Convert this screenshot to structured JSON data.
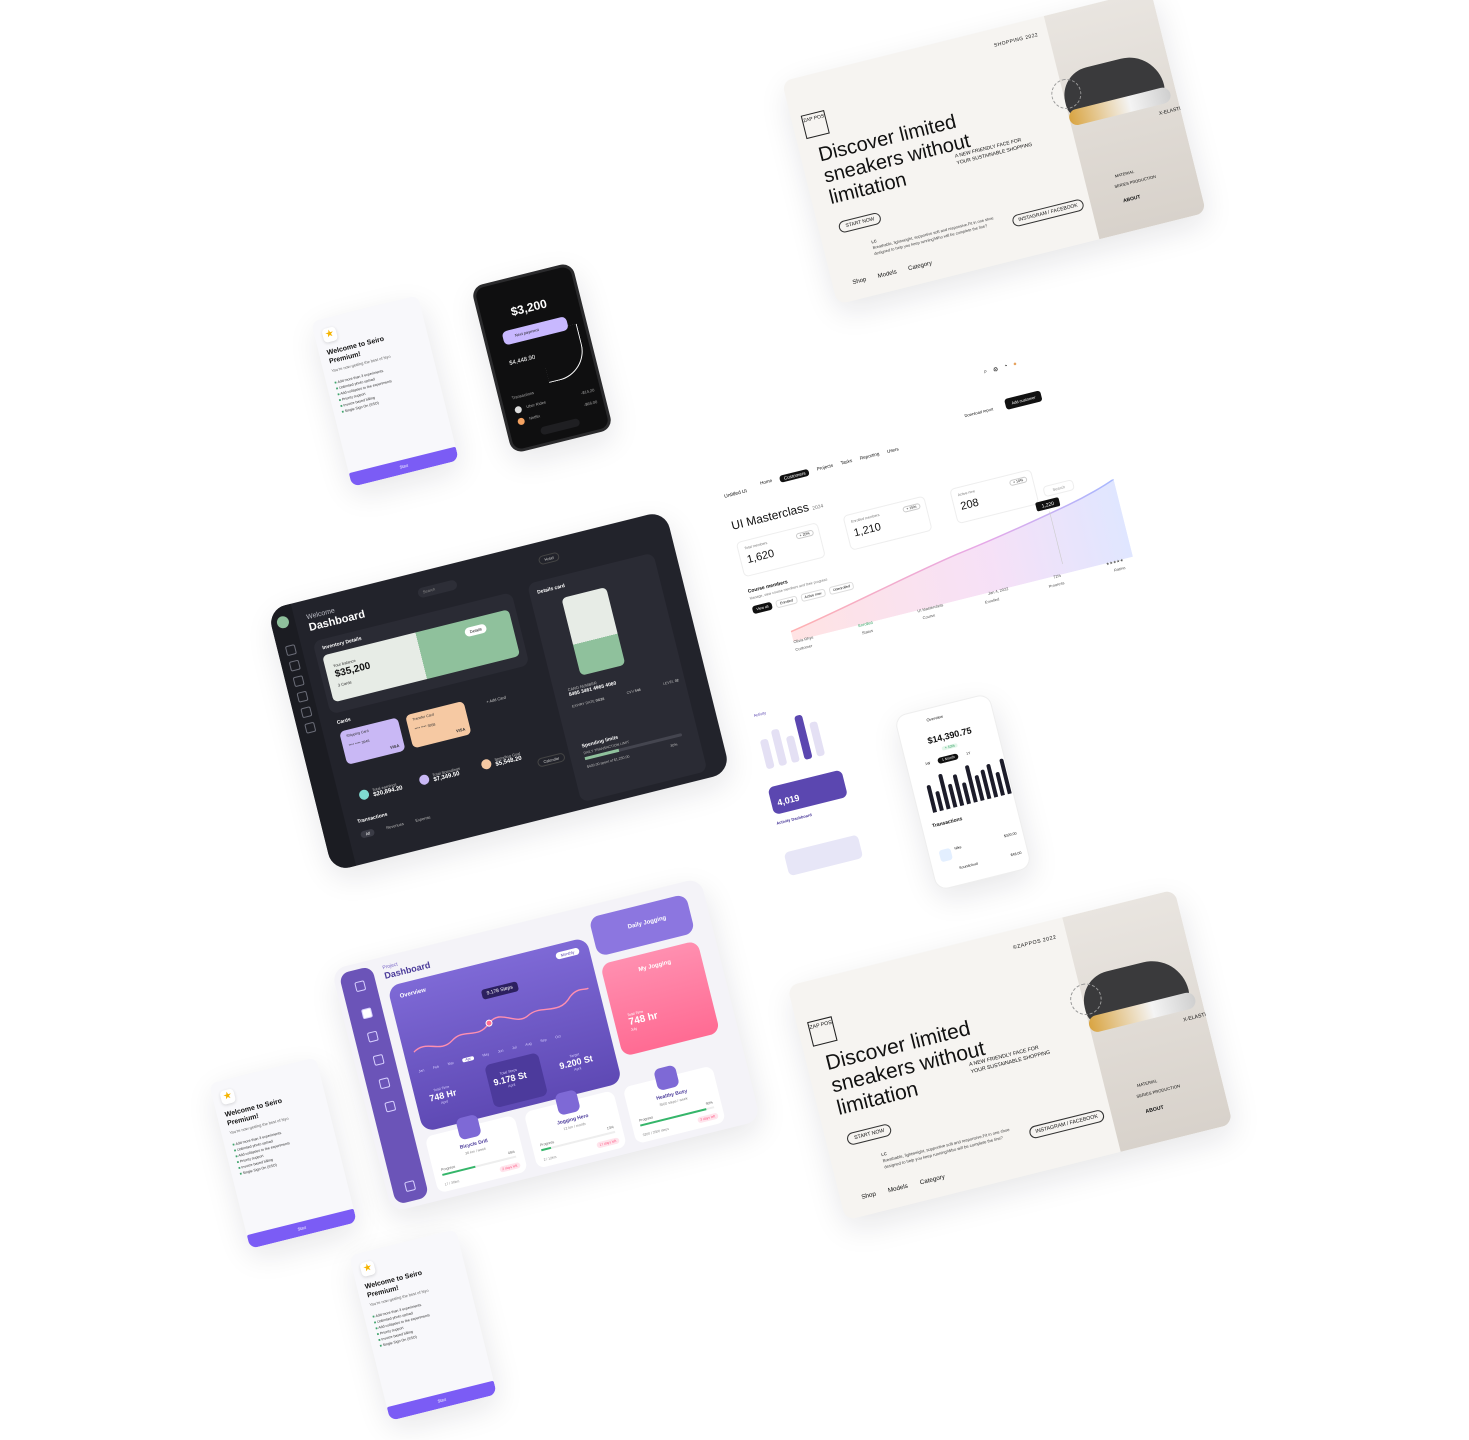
{
  "sneaker": {
    "top_label_1": "SHOPPING 2022",
    "top_label_2": "©ZAPPOS 2022",
    "logo": "ZAP POS",
    "title": "Discover limited sneakers without limitation",
    "tagline": "A NEW FRIENDLY FACE FOR YOUR SUSTAINABLE SHOPPING",
    "cta": "START NOW",
    "desc_mark": "LC",
    "description": "Breathable, lightweight, supportive soft and responsive.Fit in one shoe designed to help you keep running!Who will be complete the line?",
    "social": "INSTAGRAM / FACEBOOK",
    "nav": [
      "Shop",
      "Models",
      "Category"
    ],
    "material": "MATERIAL",
    "series": "SERIES PRODUCTION",
    "about": "ABOUT",
    "elastic": "X-ELASTIC"
  },
  "premium": {
    "title": "Welcome to Seiro Premium!",
    "subtitle": "You're now getting the best of Nyo",
    "features": [
      "Add more than 3 experiments",
      "Unlimited photo upload",
      "Add collapses to the experiments",
      "Priority support",
      "Invoice based billing",
      "Single Sign On (SSO)"
    ],
    "cta": "Start"
  },
  "wallet": {
    "balance": "$3,200",
    "next_payment": "Next payment",
    "amount": "$4,448.90",
    "transactions": "Transactions",
    "tx1": "Uber Rides",
    "tx2": "Netflix",
    "tx1_amt": "-$14.20",
    "tx2_amt": "-$66.00"
  },
  "dark": {
    "welcome": "Welcome",
    "title": "Dashboard",
    "search": "Search",
    "hotel": "Hotel",
    "inventory": "Inventory Details",
    "total_balance_label": "Your balance",
    "total_balance": "$35,200",
    "cards_count": "3 Cards",
    "details": "Details",
    "cards": "Cards",
    "add_card": "+ Add Card",
    "card1_type": "Shipping Card",
    "card1_num": "**** **** 3946",
    "card1_brand": "VISA",
    "card2_type": "Transfer Card",
    "card2_num": "**** **** 3958",
    "card2_brand": "VISA",
    "total_earnings_label": "Total earnings",
    "total_earnings": "$20,894.20",
    "total_spendings_label": "Total Spendings",
    "total_spendings": "$7,349.50",
    "spending_goal_label": "Spending Goal",
    "spending_goal": "$5,548.20",
    "details_card": "Details card",
    "card_number_label": "CARD NUMBER",
    "card_number": "8465 3461 4965 4060",
    "expiry_label": "EXPIRY DATE",
    "expiry": "06/28",
    "cvv_label": "CVV",
    "cvv": "546",
    "level_label": "LEVEL",
    "level": "02",
    "spending_limits": "Spending limits",
    "limit_note": "DAILY TRANSACTION LIMIT",
    "limit_value": "$400.00 spent of $1,250.00",
    "limit_pct": "30%",
    "calendar": "Calendar",
    "transactions": "Transactions",
    "tabs": [
      "All",
      "Revenues",
      "Expense"
    ]
  },
  "master": {
    "brand": "Untitled UI",
    "nav": [
      "Home",
      "Customers",
      "Projects",
      "Tasks",
      "Reporting",
      "Users"
    ],
    "download": "Download report",
    "add": "Add customer",
    "title": "UI Masterclass",
    "year": "2024",
    "stats": [
      {
        "label": "Total members",
        "value": "1,620",
        "badge": "+ 20%"
      },
      {
        "label": "Enrolled members",
        "value": "1,210",
        "badge": "+ 15%"
      },
      {
        "label": "Active now",
        "value": "208",
        "badge": "+ 10%"
      }
    ],
    "course_members": "Course members",
    "course_sub": "Manage, view course members and their progress",
    "filters": [
      "View all",
      "Enrolled",
      "Active now",
      "Unenrolled"
    ],
    "search": "Search",
    "tooltip": "1,220",
    "row": [
      "Customer",
      "Status",
      "Course",
      "Enrolled",
      "Progress",
      "Rating"
    ],
    "person": "Olivia Rhye",
    "status": "Enrolled",
    "course": "UI Masterclass",
    "date": "Jan 4, 2022",
    "progress": "72%",
    "rating": "★★★★★"
  },
  "fitness": {
    "project": "Project",
    "title": "Dashboard",
    "search": "Search",
    "overview": "Overview",
    "period": "Monthly",
    "tooltip_value": "9.178",
    "tooltip_unit": "Steps",
    "months": [
      "Jan",
      "Feb",
      "Mar",
      "Apr",
      "May",
      "Jun",
      "Jul",
      "Aug",
      "Sep",
      "Oct"
    ],
    "total_time_label": "Total Time",
    "total_time": "748 Hr",
    "total_steps_label": "Total Steps",
    "total_steps": "9.178 St",
    "target_label": "Target",
    "target": "9.200 St",
    "period_label": "April",
    "daily": "Daily Jogging",
    "my_jog": "My Jogging",
    "my_total_label": "Total Time",
    "my_total": "748 hr",
    "my_period": "July",
    "tiles": [
      {
        "name": "Bicycle Drill",
        "sub": "36 km / week",
        "pct": "45%",
        "goal": "17 / 30km",
        "tag": "2 days left",
        "fill": 0.45
      },
      {
        "name": "Jogging Hero",
        "sub": "12 km / month",
        "pct": "13%",
        "goal": "2 / 12km",
        "tag": "17 days left",
        "fill": 0.13
      },
      {
        "name": "Healthy Busy",
        "sub": "3500 steps / week",
        "pct": "90%",
        "goal": "3200 / 3500 steps",
        "tag": "3 days left",
        "fill": 0.9
      }
    ],
    "progress": "Progress"
  },
  "activity": {
    "label": "Activity",
    "value": "4,019",
    "dashboard": "Activity Dashboard",
    "bar_values": [
      0.6,
      0.75,
      0.55,
      0.9,
      0.7
    ]
  },
  "finance": {
    "overview": "Overview",
    "balance": "$14,390.75",
    "change": "+ 10%",
    "segments": [
      "1W",
      "1 Month",
      "1Y"
    ],
    "transactions": "Transactions",
    "rows": [
      {
        "name": "Nike",
        "amount": "$320.00"
      },
      {
        "name": "Soundcloud",
        "amount": "$48.00"
      }
    ],
    "bar_values": [
      0.7,
      0.5,
      0.9,
      0.6,
      0.8,
      0.55,
      0.95,
      0.65,
      0.75,
      0.85,
      0.6,
      0.9
    ]
  }
}
